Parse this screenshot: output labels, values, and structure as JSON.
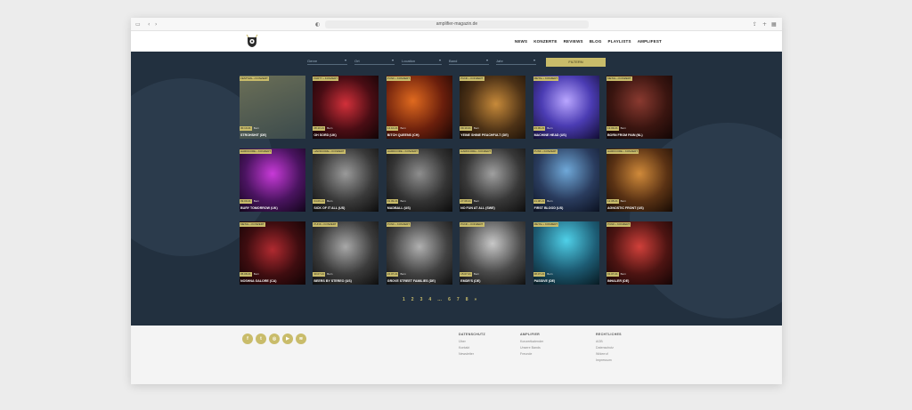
{
  "browser": {
    "url": "amplifier-magazin.de"
  },
  "nav": [
    "NEWS",
    "KONZERTE",
    "REVIEWS",
    "BLOG",
    "PLAYLISTS",
    "AMPLIFEST"
  ],
  "filters": [
    {
      "label": "Genre"
    },
    {
      "label": "Ort"
    },
    {
      "label": "Location"
    },
    {
      "label": "Band"
    },
    {
      "label": "Jahr"
    }
  ],
  "search_label": "FILTERN",
  "cards": [
    {
      "tag": "FESTIVAL • KONZERT",
      "date": "30.10.21",
      "loc": "Bern",
      "title": "STROHSHIT (DE)"
    },
    {
      "tag": "PARTY • KONZERT",
      "date": "28.10.21",
      "loc": "Bern",
      "title": "OH SORD (UK)"
    },
    {
      "tag": "PUNK • KONZERT",
      "date": "14.10.21",
      "loc": "Bern",
      "title": "BITCH QUEENS (CH)"
    },
    {
      "tag": "PUNK • KONZERT",
      "date": "09.10.21",
      "loc": "Bern",
      "title": "YEINE SHINE PEACHFULT (DE)"
    },
    {
      "tag": "METAL • KONZERT",
      "date": "23.09.21",
      "loc": "Bern",
      "title": "MACHINE HEAD (US)"
    },
    {
      "tag": "METAL • KONZERT",
      "date": "13.09.21",
      "loc": "Bern",
      "title": "BORN FROM PAIN (NL)"
    },
    {
      "tag": "HARDCORE • KONZERT",
      "date": "09.09.21",
      "loc": "Bern",
      "title": "BURY TOMORROW (UK)"
    },
    {
      "tag": "HARDCORE • KONZERT",
      "date": "04.09.21",
      "loc": "Bern",
      "title": "SICK OF IT ALL (US)"
    },
    {
      "tag": "HARDCORE • KONZERT",
      "date": "01.09.21",
      "loc": "Bern",
      "title": "MADBALL (US)"
    },
    {
      "tag": "HARDCORE • KONZERT",
      "date": "27.08.21",
      "loc": "Bern",
      "title": "NO FUN AT ALL (SWE)"
    },
    {
      "tag": "PUNK • KONZERT",
      "date": "21.08.21",
      "loc": "Bern",
      "title": "FIRST BLOOD (US)"
    },
    {
      "tag": "HARDCORE • KONZERT",
      "date": "12.08.21",
      "loc": "Bern",
      "title": "AGNOSTIC FRONT (US)"
    },
    {
      "tag": "METAL • KONZERT",
      "date": "05.08.21",
      "loc": "Bern",
      "title": "NOSHNA GALORE (CA)"
    },
    {
      "tag": "PUNK • KONZERT",
      "date": "30.07.21",
      "loc": "Bern",
      "title": "BEERS BY STEREO (US)"
    },
    {
      "tag": "PUNK • KONZERT",
      "date": "22.07.21",
      "loc": "Bern",
      "title": "GROVE STREET FAMILIES (DE)"
    },
    {
      "tag": "PUNK • KONZERT",
      "date": "15.07.21",
      "loc": "Bern",
      "title": "EMDR'S (DE)"
    },
    {
      "tag": "METAL • KONZERT",
      "date": "08.07.21",
      "loc": "Bern",
      "title": "PASSIVE (DE)"
    },
    {
      "tag": "PUNK • KONZERT",
      "date": "01.07.21",
      "loc": "Bern",
      "title": "INHALER (DE)"
    }
  ],
  "pagination": [
    "1",
    "2",
    "3",
    "4",
    "…",
    "6",
    "7",
    "8",
    "»"
  ],
  "footer": {
    "columns": [
      {
        "heading": "DATENSCHUTZ",
        "links": [
          "Über",
          "Kontakt",
          "Newsletter"
        ]
      },
      {
        "heading": "AMPLIFIER",
        "links": [
          "Konzertkalender",
          "Unsere Bands",
          "Freunde"
        ]
      },
      {
        "heading": "RECHTLICHES",
        "links": [
          "AGB",
          "Datenschutz",
          "Widerruf",
          "Impressum"
        ]
      }
    ]
  },
  "colors": {
    "accent": "#c9bc6a",
    "panel": "#22303f"
  }
}
